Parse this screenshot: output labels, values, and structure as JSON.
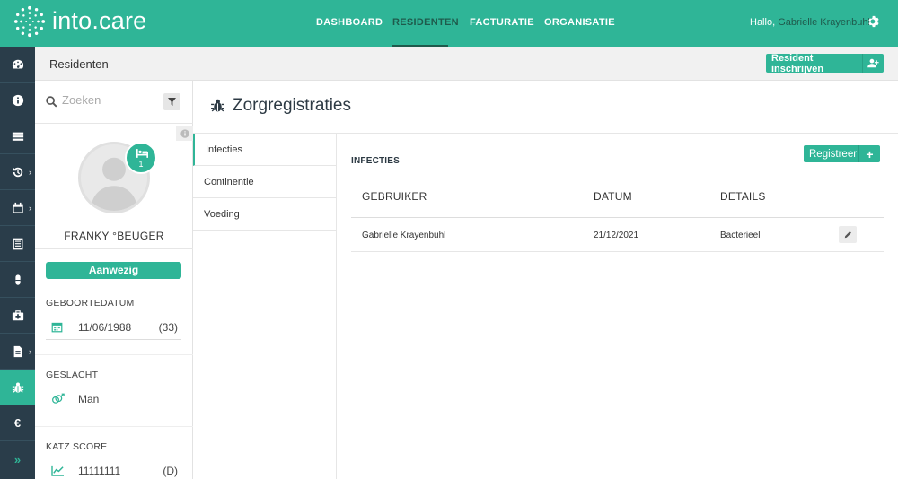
{
  "brand": {
    "name": "into.care"
  },
  "nav": {
    "items": [
      {
        "label": "DASHBOARD"
      },
      {
        "label": "RESIDENTEN"
      },
      {
        "label": "FACTURATIE"
      },
      {
        "label": "ORGANISATIE"
      }
    ],
    "active_index": 1,
    "greeting": "Hallo,",
    "user_name": "Gabrielle Krayenbuhl"
  },
  "sidebar": {
    "icons": [
      "dashboard-icon",
      "info-icon",
      "list-icon",
      "history-icon",
      "calendar-icon",
      "report-icon",
      "pill-icon",
      "medkit-icon",
      "document-icon",
      "bug-icon",
      "euro-icon",
      "expand-icon"
    ],
    "euro_symbol": "€",
    "expand_symbol": "»",
    "active": "bug-icon"
  },
  "subheader": {
    "title": "Residenten",
    "enroll_label": "Resident inschrijven"
  },
  "resident": {
    "search_placeholder": "Zoeken",
    "room_number": "1",
    "name": "FRANKY °BEUGER",
    "status": "Aanwezig",
    "birthdate_label": "GEBOORTEDATUM",
    "birthdate": "11/06/1988",
    "age": "(33)",
    "gender_label": "GESLACHT",
    "gender": "Man",
    "katz_label": "KATZ SCORE",
    "katz": "11111111",
    "katz_class": "(D)"
  },
  "page": {
    "title": "Zorgregistraties",
    "tabs": [
      {
        "label": "Infecties"
      },
      {
        "label": "Continentie"
      },
      {
        "label": "Voeding"
      }
    ],
    "active_tab": 0,
    "section_title": "INFECTIES",
    "register_label": "Registreer",
    "table": {
      "headers": [
        "GEBRUIKER",
        "DATUM",
        "DETAILS"
      ],
      "rows": [
        {
          "user": "Gabrielle Krayenbuhl",
          "date": "21/12/2021",
          "details": "Bacterieel"
        }
      ]
    }
  },
  "colors": {
    "accent": "#2fb597",
    "rail": "#2a3d4a",
    "title": "#2d3a44"
  }
}
